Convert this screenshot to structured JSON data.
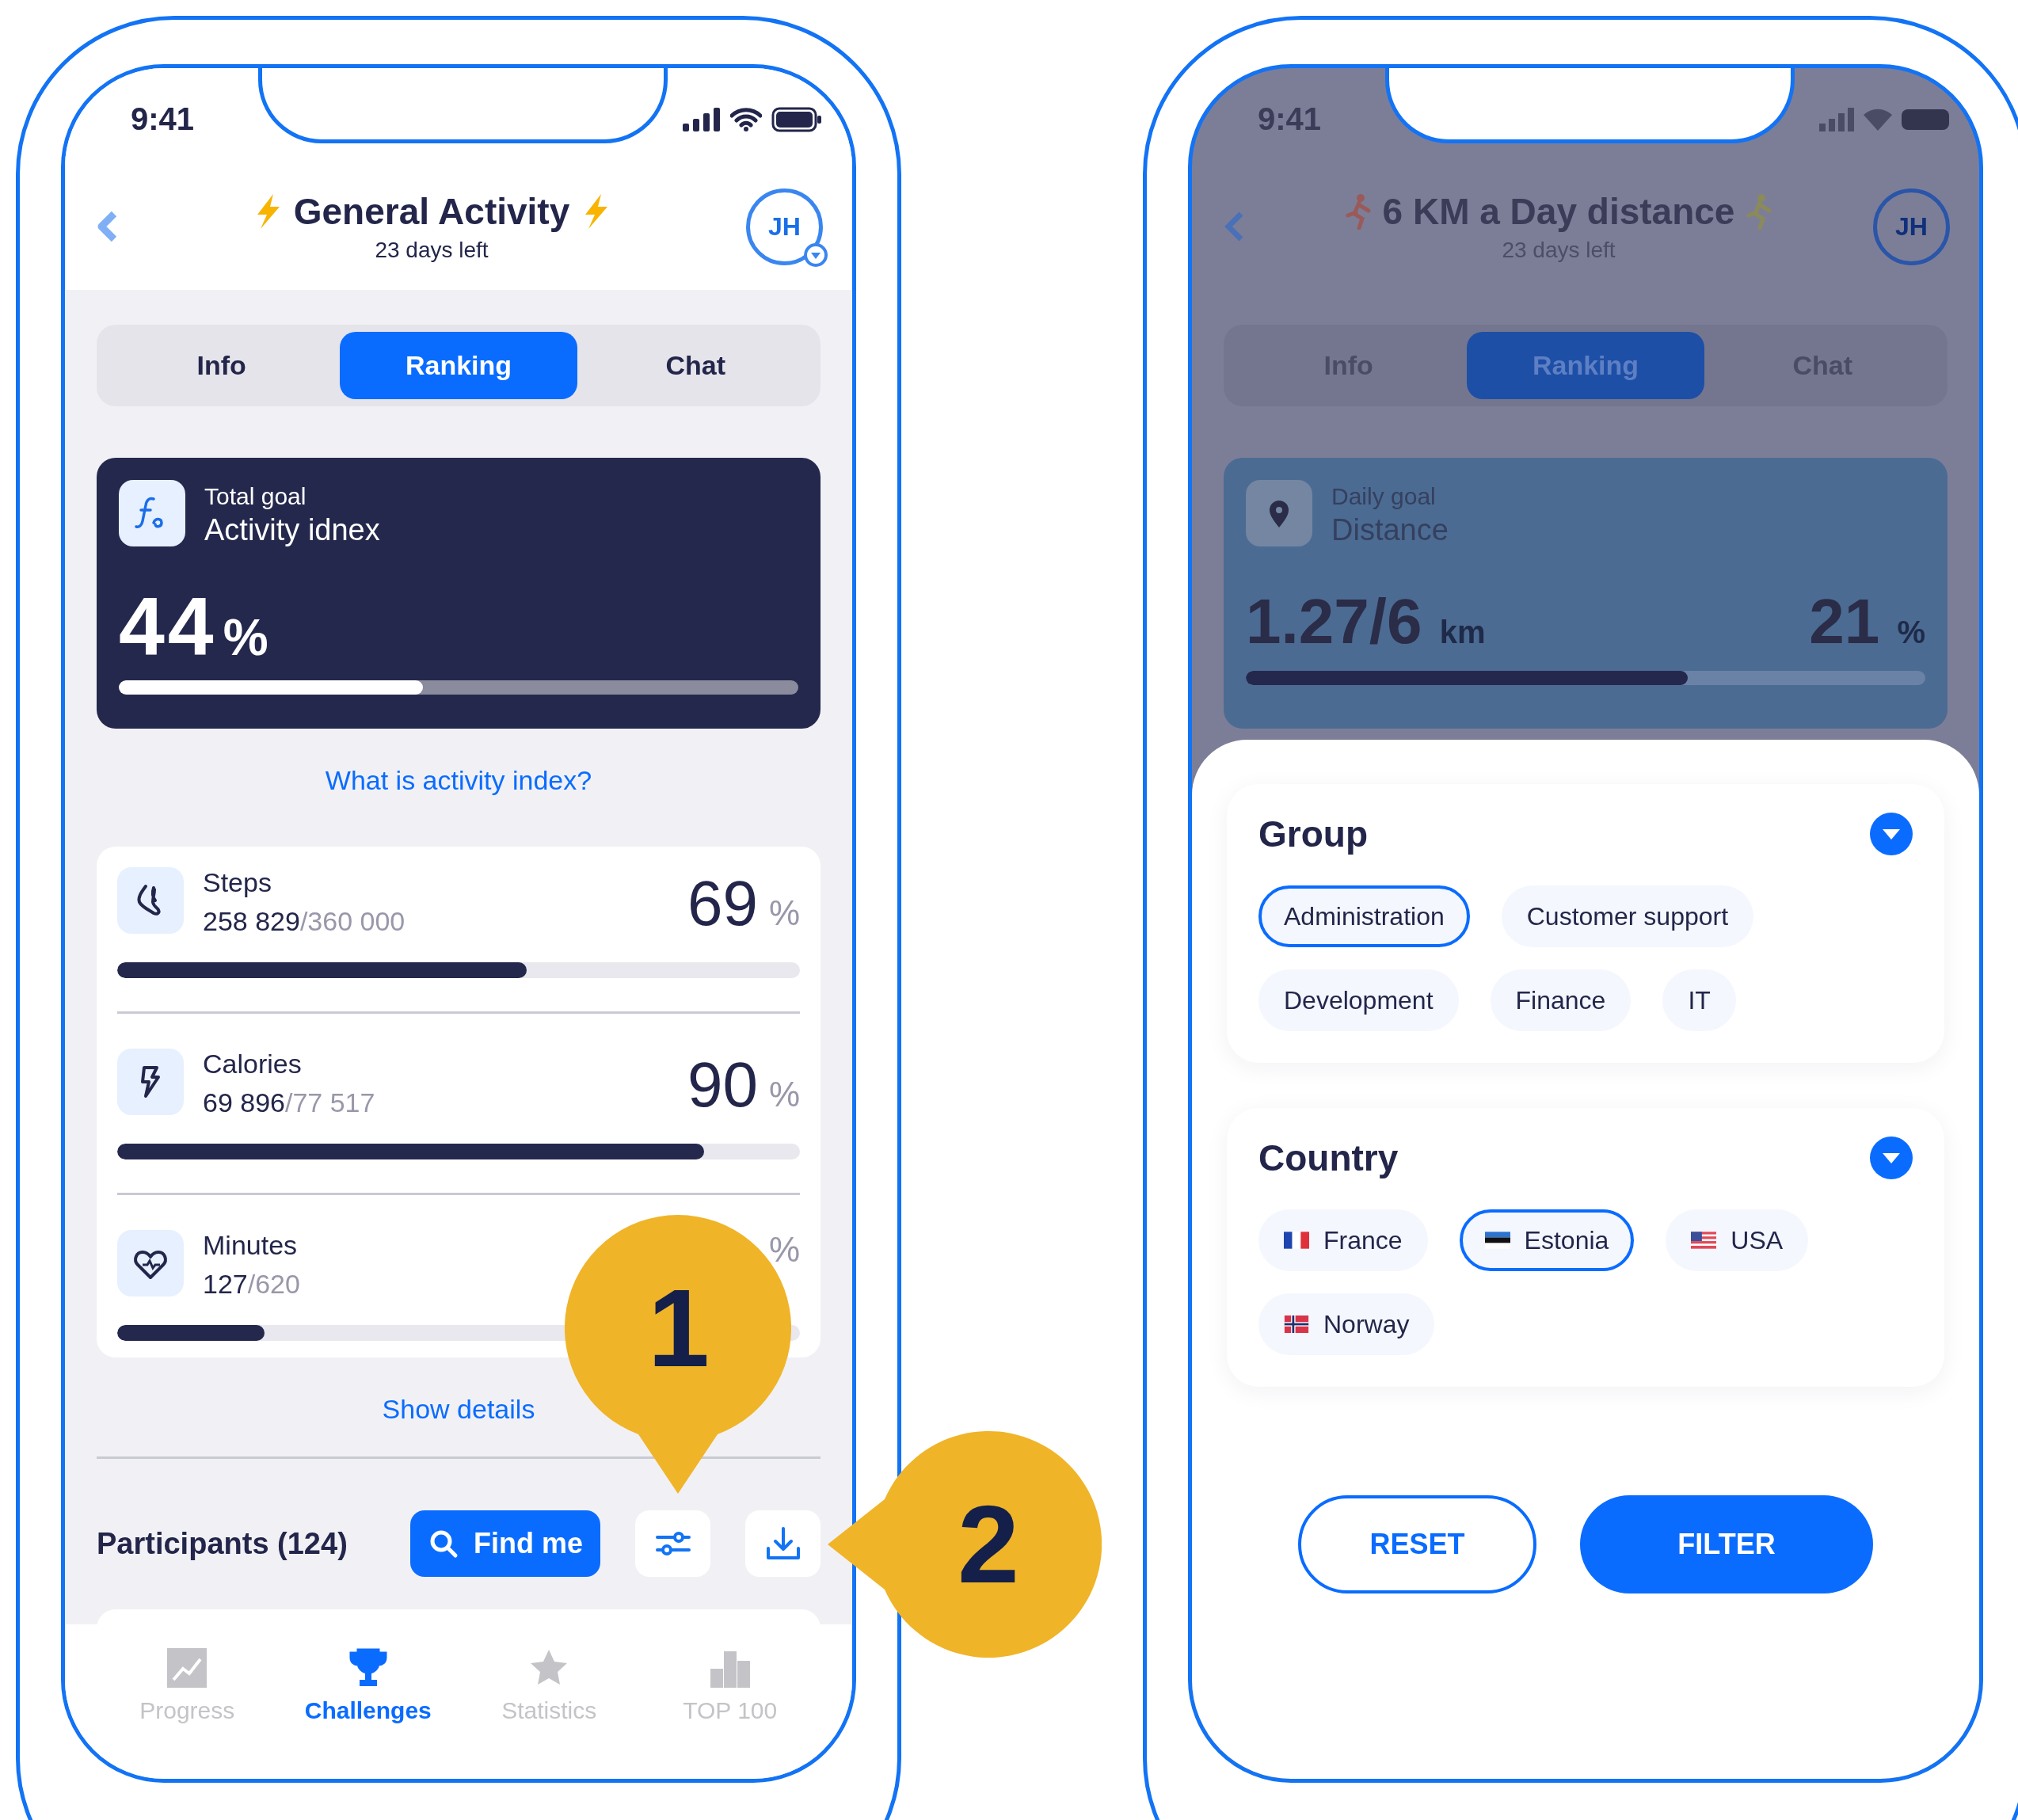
{
  "challenge_screen": {
    "status_bar": {
      "time": "9:41"
    },
    "header": {
      "title": "General Activity",
      "subtitle": "23 days left",
      "avatar": "JH"
    },
    "tabs": [
      {
        "label": "Info",
        "selected": false
      },
      {
        "label": "Ranking",
        "selected": true
      },
      {
        "label": "Chat",
        "selected": false
      }
    ],
    "goal_card": {
      "caption": "Total goal",
      "title": "Activity idnex",
      "value": "44",
      "unit": "%",
      "level": 0.447
    },
    "info_link": "What is activity index?",
    "metrics": [
      {
        "kind": "steps",
        "name": "Steps",
        "current": "258 829",
        "target": "/360 000",
        "percent": "69",
        "unit": "%",
        "level": 0.6
      },
      {
        "kind": "calories",
        "name": "Calories",
        "current": "69 896",
        "target": "/77 517",
        "percent": "90",
        "unit": "%",
        "level": 0.86
      },
      {
        "kind": "minutes",
        "name": "Minutes",
        "current": "127",
        "target": "/620",
        "unit": "%",
        "level": 0.216
      }
    ],
    "show_details": "Show details",
    "participants": {
      "label": "Participants (124)",
      "find_button": "Find me"
    },
    "bottom_nav": [
      {
        "kind": "progress",
        "label": "Progress",
        "selected": false
      },
      {
        "kind": "challenges",
        "label": "Challenges",
        "selected": true
      },
      {
        "kind": "statistics",
        "label": "Statistics",
        "selected": false
      },
      {
        "kind": "top",
        "label": "TOP 100",
        "selected": false
      }
    ]
  },
  "callouts": [
    {
      "number": "1"
    },
    {
      "number": "2"
    }
  ],
  "filter_screen": {
    "background": {
      "time": "9:41",
      "title": "6 KM a Day distance",
      "subtitle": "23 days left",
      "avatar": "JH",
      "tabs": [
        {
          "label": "Info",
          "selected": false
        },
        {
          "label": "Ranking",
          "selected": true
        },
        {
          "label": "Chat",
          "selected": false
        }
      ],
      "goal_card": {
        "caption": "Daily goal",
        "title": "Distance",
        "value": "1.27",
        "target": "/6",
        "unit": "km",
        "percent": "21",
        "percent_unit": "%",
        "level": 0.65
      }
    },
    "sections": [
      {
        "title": "Group",
        "options": [
          {
            "label": "Administration",
            "selected": true
          },
          {
            "label": "Customer support",
            "selected": false
          },
          {
            "label": "Development",
            "selected": false
          },
          {
            "label": "Finance",
            "selected": false
          },
          {
            "label": "IT",
            "selected": false
          }
        ]
      },
      {
        "title": "Country",
        "options": [
          {
            "kind": "fr",
            "label": "France",
            "selected": false
          },
          {
            "kind": "ee",
            "label": "Estonia",
            "selected": true
          },
          {
            "kind": "us",
            "label": "USA",
            "selected": false
          },
          {
            "kind": "no",
            "label": "Norway",
            "selected": false
          }
        ]
      }
    ],
    "buttons": {
      "reset": "RESET",
      "filter": "FILTER"
    }
  }
}
